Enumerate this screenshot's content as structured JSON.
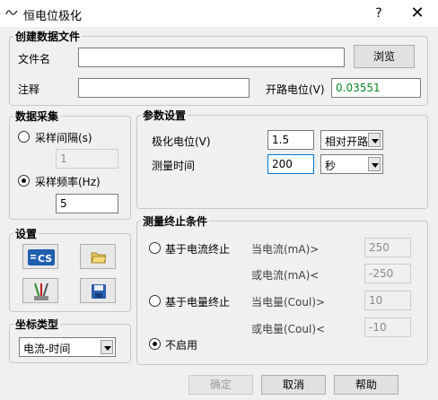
{
  "window": {
    "title": "恒电位极化",
    "help_glyph": "?",
    "close_glyph": "✕"
  },
  "create_file": {
    "legend": "创建数据文件",
    "filename_label": "文件名",
    "filename_value": "",
    "browse_label": "浏览",
    "comment_label": "注释",
    "comment_value": "",
    "ocp_label": "开路电位(V)",
    "ocp_value": "0.03551"
  },
  "acquisition": {
    "legend": "数据采集",
    "interval_label": "采样间隔(s)",
    "interval_value": "1",
    "frequency_label": "采样频率(Hz)",
    "frequency_value": "5",
    "selected": "frequency"
  },
  "params": {
    "legend": "参数设置",
    "potential_label": "极化电位(V)",
    "potential_value": "1.5",
    "potential_ref": "相对开路",
    "time_label": "测量时间",
    "time_value": "200",
    "time_unit": "秒"
  },
  "settings": {
    "legend": "设置",
    "icons": [
      "cs-icon",
      "open-folder-icon",
      "electrode-icon",
      "save-icon"
    ]
  },
  "coord": {
    "legend": "坐标类型",
    "value": "电流-时间"
  },
  "stop": {
    "legend": "测量终止条件",
    "current_option": "基于电流终止",
    "current_gt_label": "当电流(mA)>",
    "current_gt_value": "250",
    "current_lt_label": "或电流(mA)<",
    "current_lt_value": "-250",
    "charge_option": "基于电量终止",
    "charge_gt_label": "当电量(Coul)>",
    "charge_gt_value": "10",
    "charge_lt_label": "或电量(Coul)<",
    "charge_lt_value": "-10",
    "disable_option": "不启用",
    "selected": "disable"
  },
  "footer": {
    "ok_label": "确定",
    "cancel_label": "取消",
    "help_label": "帮助"
  }
}
